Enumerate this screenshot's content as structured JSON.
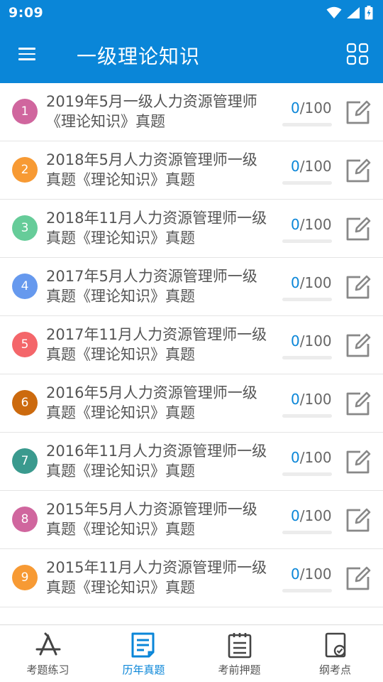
{
  "status": {
    "time": "9:09"
  },
  "appbar": {
    "title": "一级理论知识",
    "menu_icon": "menu-icon",
    "grid_icon": "grid-icon"
  },
  "colors": {
    "primary": "#0a86d8"
  },
  "list": [
    {
      "index": "1",
      "title": "2019年5月一级人力资源管理师《理论知识》真题",
      "done": "0",
      "total": "/100",
      "progress": 0,
      "color": "#d0669e"
    },
    {
      "index": "2",
      "title": "2018年5月人力资源管理师一级真题《理论知识》真题",
      "done": "0",
      "total": "/100",
      "progress": 0,
      "color": "#f79a34"
    },
    {
      "index": "3",
      "title": "2018年11月人力资源管理师一级真题《理论知识》真题",
      "done": "0",
      "total": "/100",
      "progress": 0,
      "color": "#66cc99"
    },
    {
      "index": "4",
      "title": "2017年5月人力资源管理师一级真题《理论知识》真题",
      "done": "0",
      "total": "/100",
      "progress": 0,
      "color": "#6699ee"
    },
    {
      "index": "5",
      "title": "2017年11月人力资源管理师一级真题《理论知识》真题",
      "done": "0",
      "total": "/100",
      "progress": 0,
      "color": "#f4666a"
    },
    {
      "index": "6",
      "title": "2016年5月人力资源管理师一级真题《理论知识》真题",
      "done": "0",
      "total": "/100",
      "progress": 0,
      "color": "#cc6a0e"
    },
    {
      "index": "7",
      "title": "2016年11月人力资源管理师一级真题《理论知识》真题",
      "done": "0",
      "total": "/100",
      "progress": 0,
      "color": "#3a9a8e"
    },
    {
      "index": "8",
      "title": "2015年5月人力资源管理师一级真题《理论知识》真题",
      "done": "0",
      "total": "/100",
      "progress": 0,
      "color": "#d0669e"
    },
    {
      "index": "9",
      "title": "2015年11月人力资源管理师一级真题《理论知识》真题",
      "done": "0",
      "total": "/100",
      "progress": 0,
      "color": "#f79a34"
    }
  ],
  "bottom_nav": [
    {
      "label": "考题练习",
      "icon": "appstore-icon",
      "active": false
    },
    {
      "label": "历年真题",
      "icon": "document-icon",
      "active": true
    },
    {
      "label": "考前押题",
      "icon": "clipboard-icon",
      "active": false
    },
    {
      "label": "纲考点",
      "icon": "book-check-icon",
      "active": false
    }
  ]
}
